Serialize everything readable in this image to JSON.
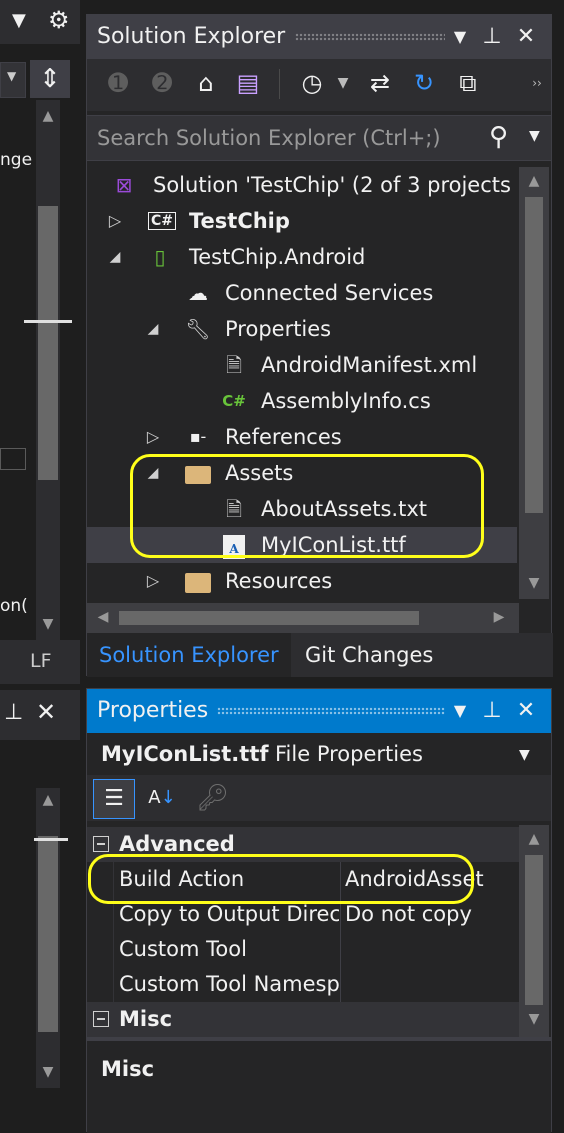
{
  "colors": {
    "background": "#1e1e1e",
    "panel": "#252526",
    "title_inactive": "#3f3f46",
    "title_active": "#007acc",
    "accent_tab": "#3794ff",
    "highlight": "#ffff1a",
    "csharp_green": "#68c43a",
    "vs_purple": "#9b4bd9"
  },
  "left_panel": {
    "partial_text_1": "nge",
    "partial_text_2": "on(",
    "lf_label": "LF"
  },
  "solution_explorer": {
    "title": "Solution Explorer",
    "search_placeholder": "Search Solution Explorer (Ctrl+;)",
    "toolbar_icons": [
      "back-icon",
      "forward-icon",
      "home-icon",
      "vs-switch-views-icon",
      "pending-changes-filter-icon",
      "sync-icon",
      "refresh-icon",
      "collapse-all-icon"
    ],
    "tree": [
      {
        "label": "Solution 'TestChip' (2 of 3 projects",
        "icon": "solution-icon"
      },
      {
        "label": "TestChip",
        "icon": "csharp-project-icon",
        "bold": true,
        "expander": "collapsed"
      },
      {
        "label": "TestChip.Android",
        "icon": "android-project-icon",
        "expander": "expanded"
      },
      {
        "label": "Connected Services",
        "icon": "connected-services-icon"
      },
      {
        "label": "Properties",
        "icon": "wrench-icon",
        "expander": "expanded"
      },
      {
        "label": "AndroidManifest.xml",
        "icon": "manifest-file-icon"
      },
      {
        "label": "AssemblyInfo.cs",
        "icon": "csharp-file-icon"
      },
      {
        "label": "References",
        "icon": "references-icon",
        "expander": "collapsed"
      },
      {
        "label": "Assets",
        "icon": "folder-open-icon",
        "expander": "expanded"
      },
      {
        "label": "AboutAssets.txt",
        "icon": "text-file-icon"
      },
      {
        "label": "MyIConList.ttf",
        "icon": "font-file-icon",
        "selected": true
      },
      {
        "label": "Resources",
        "icon": "folder-icon",
        "expander": "collapsed"
      }
    ],
    "tabs": [
      {
        "label": "Solution Explorer",
        "active": true
      },
      {
        "label": "Git Changes",
        "active": false
      }
    ]
  },
  "properties": {
    "title": "Properties",
    "object_name": "MyIConList.ttf",
    "object_type": "File Properties",
    "categories": [
      {
        "name": "Advanced",
        "rows": [
          {
            "name": "Build Action",
            "value": "AndroidAsset"
          },
          {
            "name": "Copy to Output Directory",
            "value": "Do not copy"
          },
          {
            "name": "Custom Tool",
            "value": ""
          },
          {
            "name": "Custom Tool Namespace",
            "value": ""
          }
        ]
      },
      {
        "name": "Misc",
        "rows": []
      }
    ],
    "description_title": "Misc"
  }
}
